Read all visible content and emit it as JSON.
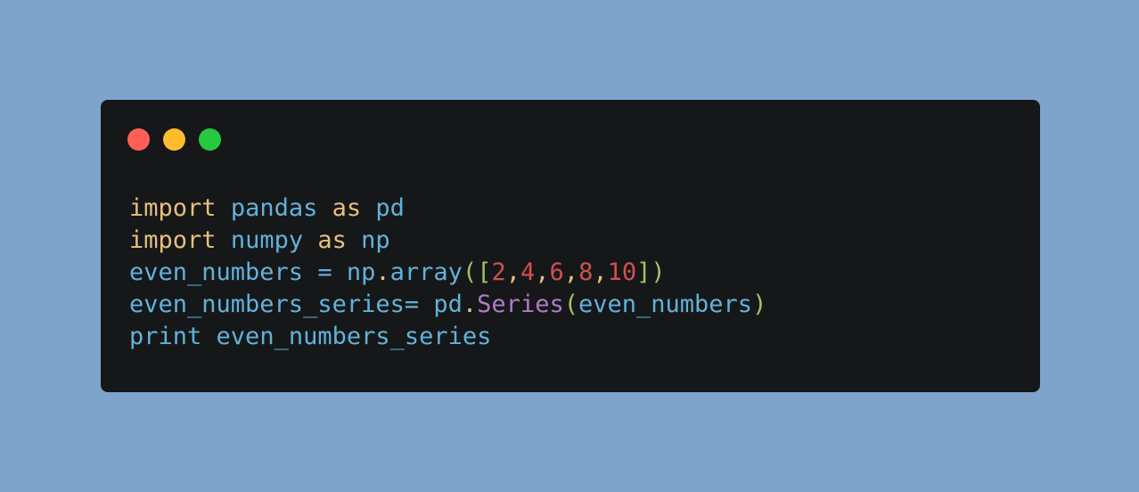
{
  "window_controls": {
    "close_color": "#ff5f56",
    "minimize_color": "#ffbd2e",
    "maximize_color": "#27c93f"
  },
  "code": {
    "line1": {
      "kw1": "import",
      "id1": "pandas",
      "kw2": "as",
      "id2": "pd"
    },
    "line2": {
      "kw1": "import",
      "id1": "numpy",
      "kw2": "as",
      "id2": "np"
    },
    "line3": {
      "var": "even_numbers",
      "eq": "=",
      "obj": "np",
      "dot": ".",
      "func": "array",
      "open_paren": "(",
      "open_bracket": "[",
      "n1": "2",
      "n2": "4",
      "n3": "6",
      "n4": "8",
      "n5": "10",
      "comma": ",",
      "close_bracket": "]",
      "close_paren": ")"
    },
    "line4": {
      "var": "even_numbers_series",
      "eq": "=",
      "obj": "pd",
      "dot": ".",
      "cls": "Series",
      "open_paren": "(",
      "arg": "even_numbers",
      "close_paren": ")"
    },
    "line5": {
      "func": "print",
      "arg": "even_numbers_series"
    }
  }
}
